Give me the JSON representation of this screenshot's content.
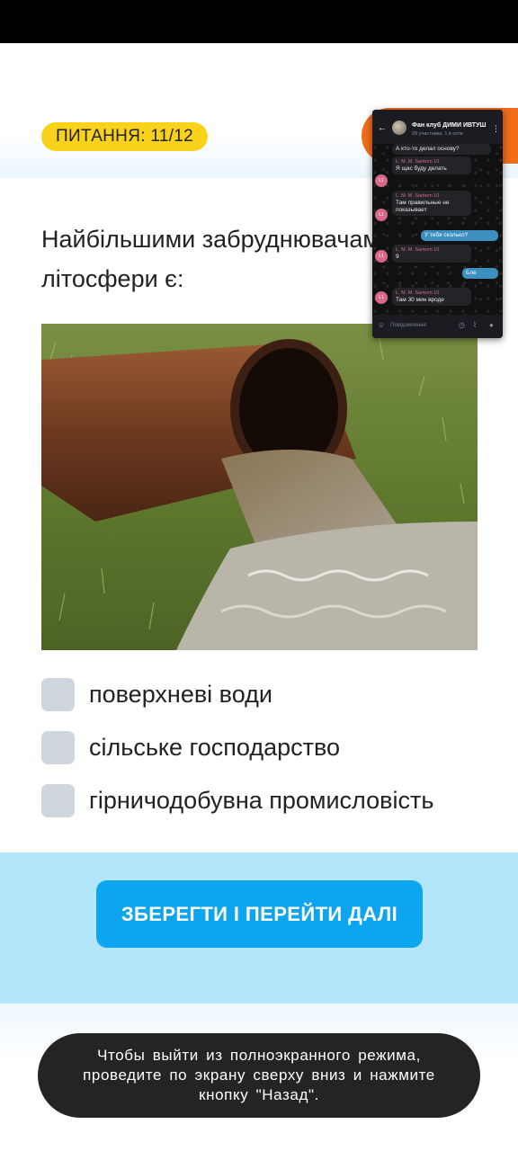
{
  "quiz": {
    "question_badge": "ПИТАННЯ: 11/12",
    "question_text": "Найбільшими забруднювачами літосфери є:",
    "answers": [
      {
        "label": "поверхневі води",
        "checked": false
      },
      {
        "label": "сільське господарство",
        "checked": false
      },
      {
        "label": "гірничодобувна промисловість",
        "checked": false
      }
    ],
    "save_button": "ЗБЕРЕГТИ І ПЕРЕЙТИ ДАЛІ"
  },
  "system_toast": {
    "text": "Чтобы выйти из полноэкранного режима, проведите по экрану сверху вниз и нажмите кнопку \"Назад\"."
  },
  "chat_overlay": {
    "title": "Фан клуб ДИМИ ИВТУШ",
    "subtitle": "29 участника, 1 в сети",
    "messages": [
      {
        "sender": "",
        "text": "А кто-то делал основу?",
        "direction": "in"
      },
      {
        "sender": "L. M. M. Santern 10",
        "text": "Я щас буду делать",
        "direction": "in"
      },
      {
        "sender": "L. M. M. Santern 10",
        "text": "Там правильные не показывает",
        "direction": "in"
      },
      {
        "sender": "",
        "text": "У тебя сколько?",
        "direction": "out"
      },
      {
        "sender": "L. M. M. Santern 10",
        "text": "9",
        "direction": "in"
      },
      {
        "sender": "",
        "text": "Бле",
        "direction": "out"
      },
      {
        "sender": "L. M. M. Santern 10",
        "text": "Там 30 мин вроде",
        "direction": "in"
      }
    ],
    "avatar_initials": "L1",
    "input_placeholder": "Повідомлення"
  },
  "colors": {
    "badge": "#f9d31b",
    "timer": "#ef6c1a",
    "primary_button": "#0ea5ef",
    "footer_bg": "#b3e6fa",
    "checkbox": "#cfd6de",
    "toast_bg": "#242424"
  }
}
